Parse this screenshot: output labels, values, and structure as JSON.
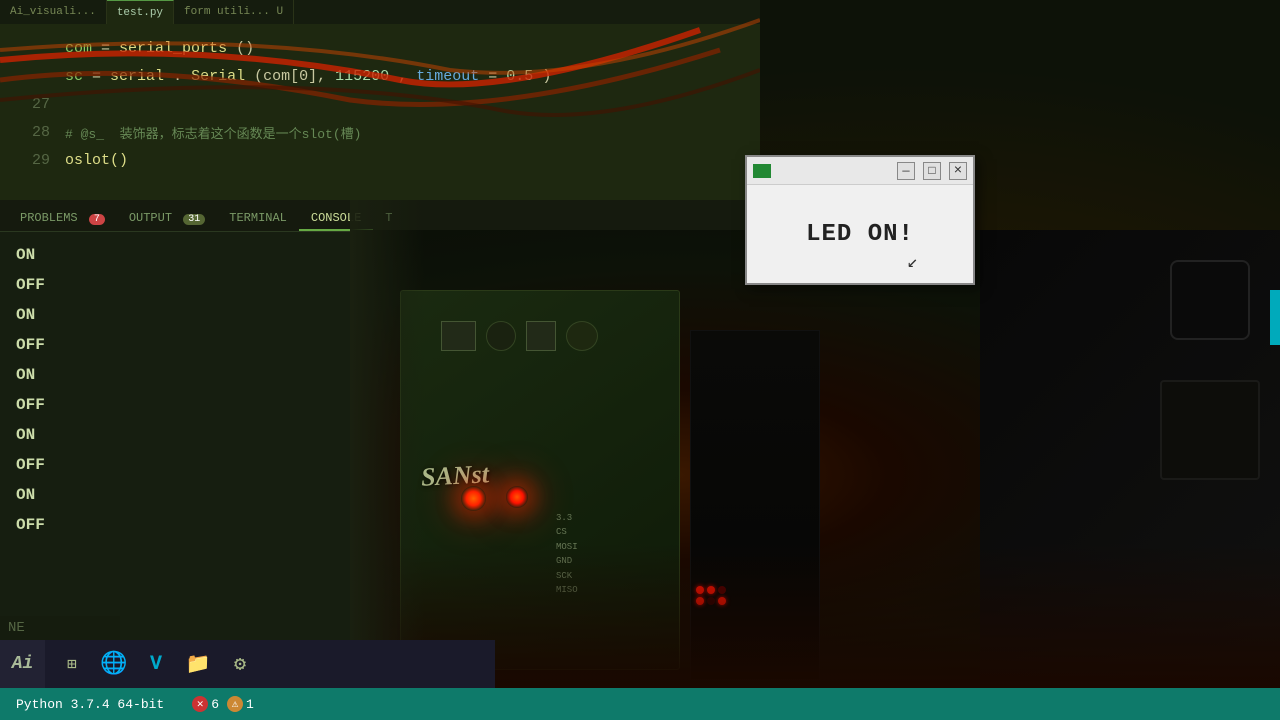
{
  "editor": {
    "file_tabs": [
      {
        "label": "Ai_visuali...",
        "active": false
      },
      {
        "label": "test.py",
        "active": true
      },
      {
        "label": "form utili... U",
        "active": false
      }
    ],
    "code_lines": [
      {
        "num": "",
        "content": "com = serial_ports()"
      },
      {
        "num": "",
        "content": "sc = serial.Serial(com[0],115200,timeout=0.5)"
      },
      {
        "num": "27",
        "content": ""
      },
      {
        "num": "28",
        "content": "# @s_  装饰器，标志着这个函数是一个slot(槽)"
      },
      {
        "num": "29",
        "content": "oslot()"
      }
    ]
  },
  "panel": {
    "tabs": [
      {
        "label": "PROBLEMS",
        "badge": "7",
        "active": false
      },
      {
        "label": "OUTPUT",
        "badge": "31",
        "active": false
      },
      {
        "label": "TERMINAL",
        "active": false
      },
      {
        "label": "CONSOLE",
        "active": true
      },
      {
        "label": "T",
        "active": false
      }
    ],
    "console_lines": [
      {
        "text": "ON"
      },
      {
        "text": "OFF"
      },
      {
        "text": "ON"
      },
      {
        "text": "OFF"
      },
      {
        "text": "ON"
      },
      {
        "text": "OFF"
      },
      {
        "text": "ON"
      },
      {
        "text": "OFF"
      },
      {
        "text": "ON"
      },
      {
        "text": "OFF"
      }
    ]
  },
  "dialog": {
    "title": "",
    "message": "LED ON!",
    "buttons": {
      "minimize": "—",
      "maximize": "□",
      "close": "×"
    }
  },
  "status_bar": {
    "python_version": "Python 3.7.4 64-bit",
    "errors": "6",
    "warnings": "1"
  },
  "taskbar": {
    "ai_label": "Ai",
    "icons": [
      "⊞",
      "🌐",
      "V",
      "📁",
      "⚙"
    ]
  },
  "board": {
    "label": "SANst",
    "pins": "3.3\nCS\nMOSI\nGND\nSCK\nMISO"
  },
  "ne_label": "NE",
  "colors": {
    "accent_teal": "#0e7a6a",
    "editor_bg": "#1e2810",
    "console_bg": "#161e10"
  }
}
